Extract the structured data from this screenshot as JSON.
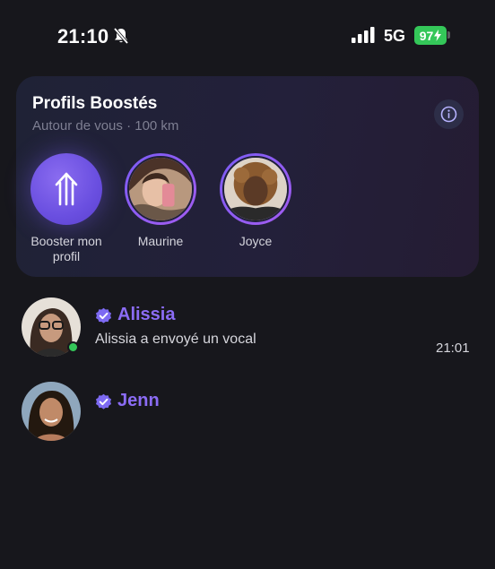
{
  "status_bar": {
    "time": "21:10",
    "network": "5G",
    "battery": "97",
    "battery_color": "#34c759"
  },
  "boost_card": {
    "title": "Profils Boostés",
    "subtitle": "Autour de vous · 100 km",
    "info_icon": "info-icon",
    "stories": [
      {
        "label": "Booster mon profil",
        "icon": "boost-arrow-icon"
      },
      {
        "label": "Maurine"
      },
      {
        "label": "Joyce"
      }
    ]
  },
  "chats": [
    {
      "name": "Alissia",
      "preview": "Alissia a envoyé un vocal",
      "time": "21:01",
      "online": true,
      "verified": true
    },
    {
      "name": "Jenn",
      "preview": "",
      "time": "",
      "online": false,
      "verified": true
    }
  ],
  "colors": {
    "accent": "#8b6cf5",
    "background": "#17171c",
    "online": "#34c759"
  }
}
